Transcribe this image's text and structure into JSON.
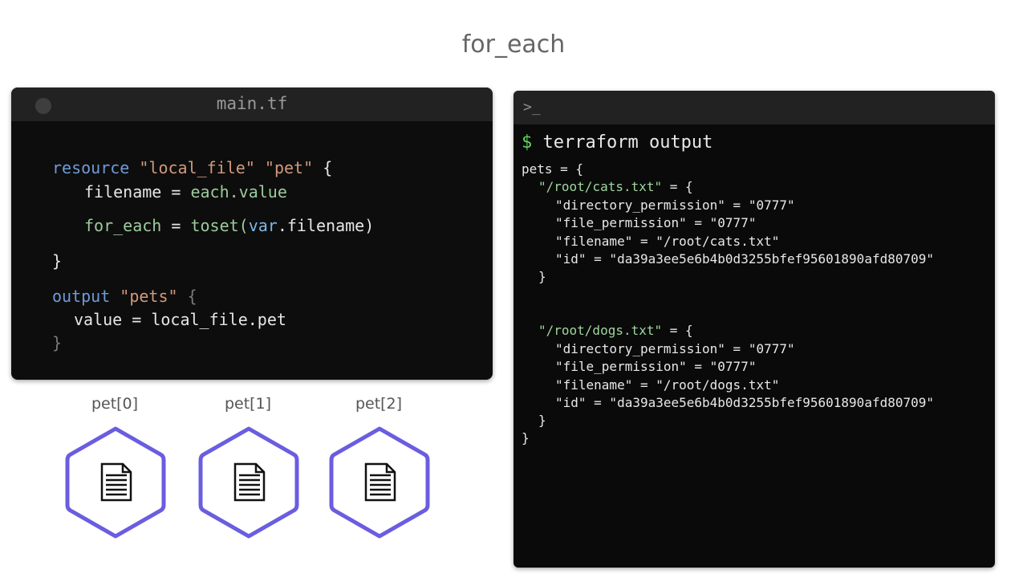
{
  "slide": {
    "title": "for_each"
  },
  "editor": {
    "filename": "main.tf",
    "code": {
      "l1_kw": "resource",
      "l1_s1": "\"local_file\"",
      "l1_s2": "\"pet\"",
      "l1_brace": "{",
      "l2_prop": "filename",
      "l2_eq": " = ",
      "l2_val": "each.value",
      "l3_prop": "for_each",
      "l3_eq": " = ",
      "l3_fn": "toset(",
      "l3_var": "var",
      "l3_dot": ".",
      "l3_attr": "filename",
      "l3_close": ")",
      "l4_brace": "}",
      "l5_kw": "output",
      "l5_s1": "\"pets\"",
      "l5_brace": "{",
      "l6_prop": "value",
      "l6_eq": " = ",
      "l6_val": "local_file.pet",
      "l7_brace": "}"
    }
  },
  "pets": [
    {
      "label": "pet[0]",
      "icon": "document-icon"
    },
    {
      "label": "pet[1]",
      "icon": "document-icon"
    },
    {
      "label": "pet[2]",
      "icon": "document-icon"
    }
  ],
  "terminal": {
    "prompt_icon": ">_",
    "dollar": "$",
    "command": " terraform output",
    "lines": {
      "l1": "pets = {",
      "l2_key": "\"/root/cats.txt\"",
      "l2_rest": " = {",
      "l3": "\"directory_permission\" = \"0777\"",
      "l4": "\"file_permission\" = \"0777\"",
      "l5": "\"filename\" = \"/root/cats.txt\"",
      "l6": "\"id\" = \"da39a3ee5e6b4b0d3255bfef95601890afd80709\"",
      "l7": "}",
      "l8_key": "\"/root/dogs.txt\"",
      "l8_rest": " = {",
      "l9": "\"directory_permission\" = \"0777\"",
      "l10": "\"file_permission\" = \"0777\"",
      "l11": "\"filename\" = \"/root/dogs.txt\"",
      "l12": "\"id\" = \"da39a3ee5e6b4b0d3255bfef95601890afd80709\"",
      "l13": "}",
      "l14": "}"
    }
  },
  "colors": {
    "hex_stroke": "#6a5de0",
    "terminal_bg": "#0a0a0a",
    "editor_bg": "#0d0d0d",
    "prompt_green": "#5fd35f"
  }
}
